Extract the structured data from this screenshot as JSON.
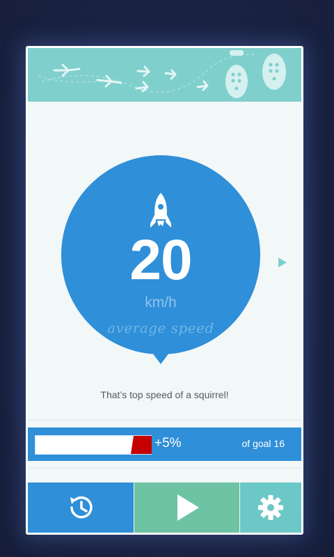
{
  "speed": {
    "value": "20",
    "unit": "km/h",
    "caption": "average speed"
  },
  "fact": "That’s top speed of a squirrel!",
  "progress": {
    "percent_text": "+5%",
    "goal_text": "of goal 16",
    "fill_fraction": 1.0
  },
  "icons": {
    "speed": "rocket-icon",
    "next": "chevron-right-icon",
    "history": "history-icon",
    "play": "play-icon",
    "settings": "gear-icon",
    "banner": "footprints-pattern"
  },
  "colors": {
    "background": "#1b2443",
    "primary_blue": "#2f8fd8",
    "banner_teal": "#7fcfcd",
    "play_green": "#6dc3a3",
    "settings_teal": "#6cc8c6",
    "progress_red": "#c40000"
  }
}
